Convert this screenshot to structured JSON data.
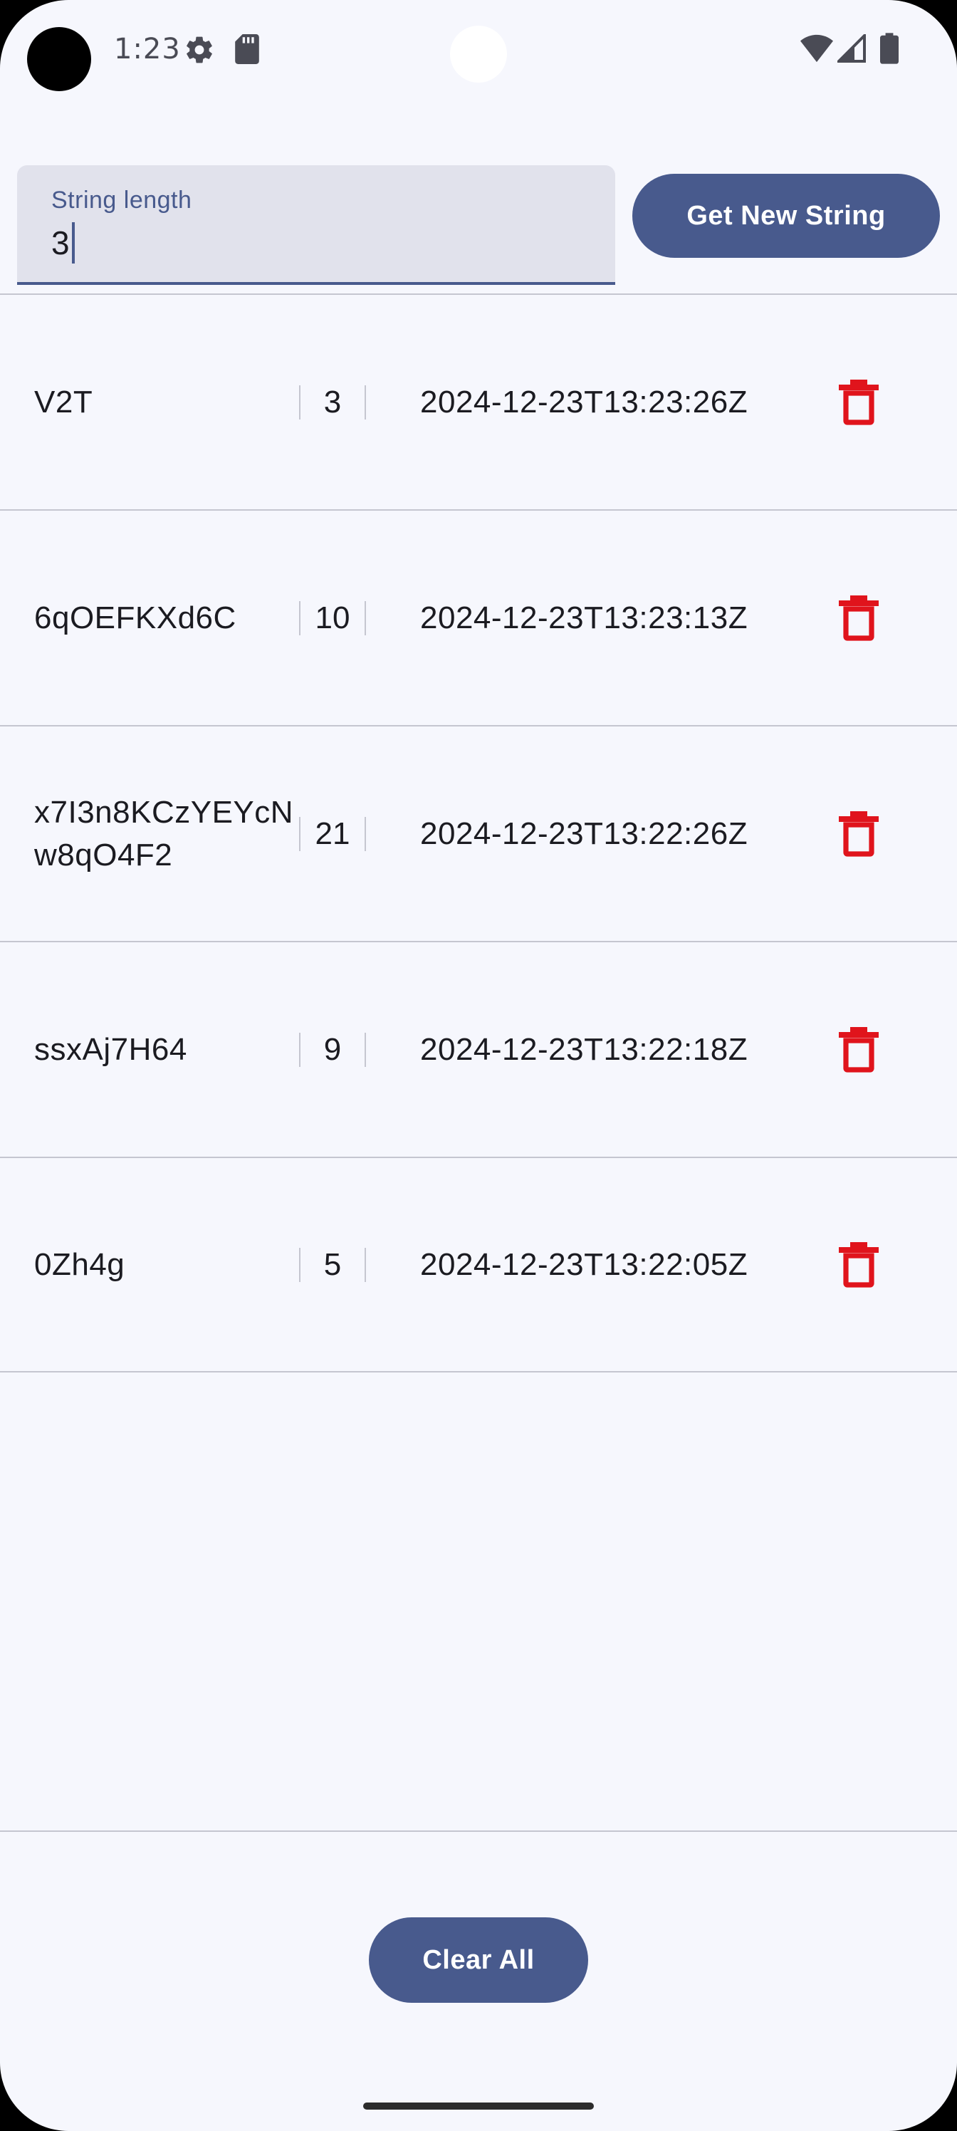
{
  "status_bar": {
    "time": "1:23"
  },
  "input": {
    "label": "String length",
    "value": "3"
  },
  "actions": {
    "get_new_string": "Get New String",
    "clear_all": "Clear All"
  },
  "rows": [
    {
      "string": "V2T",
      "length": "3",
      "timestamp": "2024-12-23T13:23:26Z"
    },
    {
      "string": "6qOEFKXd6C",
      "length": "10",
      "timestamp": "2024-12-23T13:23:13Z"
    },
    {
      "string": "x7I3n8KCzYEYcNw8qO4F2",
      "length": "21",
      "timestamp": "2024-12-23T13:22:26Z"
    },
    {
      "string": "ssxAj7H64",
      "length": "9",
      "timestamp": "2024-12-23T13:22:18Z"
    },
    {
      "string": "0Zh4g",
      "length": "5",
      "timestamp": "2024-12-23T13:22:05Z"
    }
  ],
  "icons": {
    "settings": "gear-icon",
    "sd_card": "sd-card-icon",
    "wifi": "wifi-icon",
    "signal": "signal-icon",
    "battery": "battery-icon",
    "delete": "trash-icon"
  },
  "colors": {
    "primary": "#485a8d",
    "delete": "#e0141c",
    "background": "#f6f7fd"
  }
}
